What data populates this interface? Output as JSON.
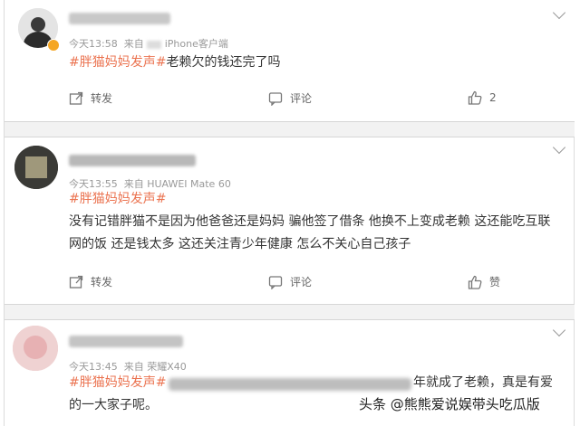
{
  "comments": [
    {
      "time": "今天13:58",
      "source_prefix": "来自",
      "source": "iPhone客户端",
      "tag": "#胖猫妈妈发声#",
      "text": "老赖欠的钱还完了吗",
      "repost_label": "转发",
      "comment_label": "评论",
      "like_label": "2"
    },
    {
      "time": "今天13:55",
      "source_prefix": "来自",
      "source": "HUAWEI Mate 60",
      "tag": "#胖猫妈妈发声#",
      "line1": "没有记错胖猫不是因为他爸爸还是妈妈 骗他签了借条 他换不上变成老赖 这还能吃互联",
      "line2": "网的饭 还是钱太多 这还关注青少年健康 怎么不关心自己孩子",
      "repost_label": "转发",
      "comment_label": "评论",
      "like_label": "赞"
    },
    {
      "time": "今天13:45",
      "source_prefix": "来自",
      "source": "荣耀X40",
      "tag": "#胖猫妈妈发声#",
      "line1_tail": "年就成了老赖，真是有爱",
      "line2": "的一大家子呢。"
    }
  ],
  "watermark": "头条 @熊熊爱说娱带头吃瓜版",
  "colors": {
    "tag": "#eb7350",
    "meta": "#999999",
    "text": "#333333"
  },
  "icons": [
    "repost-icon",
    "comment-icon",
    "like-icon",
    "chevron-down-icon",
    "verified-badge-icon"
  ]
}
